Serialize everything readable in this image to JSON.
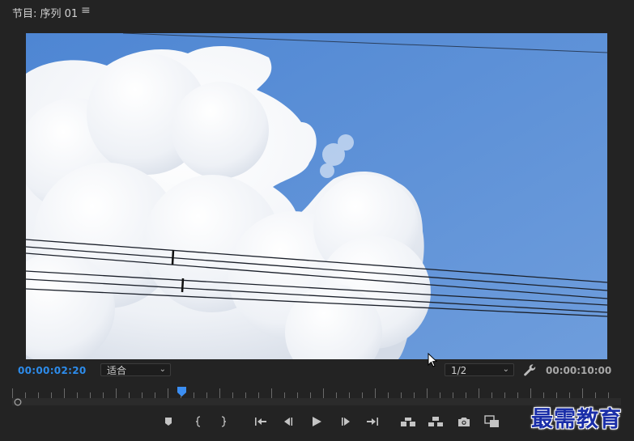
{
  "panel": {
    "title": "节目: 序列 01",
    "menu_icon": "hamburger-menu-icon"
  },
  "monitor": {
    "current_timecode": "00:00:02:20",
    "zoom_value": "适合",
    "resolution_value": "1/2",
    "duration_timecode": "00:00:10:00",
    "settings_icon": "wrench-icon"
  },
  "timeline": {
    "playhead_position_fraction": 0.278
  },
  "transport": {
    "buttons": [
      {
        "name": "add-marker-button",
        "icon": "marker-icon"
      },
      {
        "name": "mark-in-button",
        "icon": "mark-in-icon"
      },
      {
        "name": "mark-out-button",
        "icon": "mark-out-icon"
      },
      {
        "name": "go-to-in-button",
        "icon": "go-to-in-icon"
      },
      {
        "name": "step-back-button",
        "icon": "step-back-icon"
      },
      {
        "name": "play-button",
        "icon": "play-icon"
      },
      {
        "name": "step-forward-button",
        "icon": "step-forward-icon"
      },
      {
        "name": "go-to-out-button",
        "icon": "go-to-out-icon"
      },
      {
        "name": "lift-button",
        "icon": "lift-icon"
      },
      {
        "name": "extract-button",
        "icon": "extract-icon"
      },
      {
        "name": "export-frame-button",
        "icon": "camera-icon"
      },
      {
        "name": "comparison-view-button",
        "icon": "comparison-view-icon"
      }
    ]
  },
  "colors": {
    "accent": "#2d8ceb",
    "panel_bg": "#232323",
    "sky": "#5c8fd6"
  },
  "watermark": {
    "text": "最需教育"
  }
}
